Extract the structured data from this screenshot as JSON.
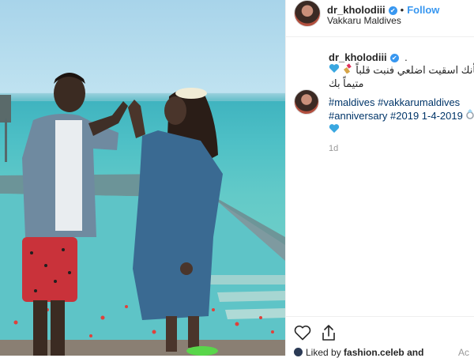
{
  "post": {
    "username": "dr_kholodiii",
    "verified_mark": "✔",
    "follow_label": "Follow",
    "separator": "•",
    "location": "Vakkaru Maldives",
    "caption_user": "dr_kholodiii",
    "caption_dot": ".",
    "caption_line1": "و كأنك اسقيت اضلعي فنبت قلباً",
    "caption_line1_emojis": [
      "blue-heart",
      "lipstick"
    ],
    "caption_line2": "متيماً بك",
    "caption_line3": ".",
    "hashtags_line1": "#maldives #vakkarumaldives",
    "hashtags_line2": "#anniversary #2019 1-4-2019",
    "time_ago": "1d",
    "liked_by_prefix": "Liked by",
    "liked_by_user": "fashion.celeb",
    "liked_by_suffix": "and",
    "add_comment_partial": "Ac"
  },
  "icons": {
    "verified": "verified-badge-icon",
    "like": "heart-outline-icon",
    "share": "share-icon",
    "ring": "ring-emoji-icon",
    "blue_heart": "blue-heart-emoji-icon",
    "lipstick": "lipstick-emoji-icon"
  },
  "colors": {
    "link_blue": "#3897f0",
    "hashtag": "#003569",
    "muted": "#999999",
    "border": "#efefef",
    "water": "#4ec0c6",
    "sky": "#a8d4ea"
  }
}
